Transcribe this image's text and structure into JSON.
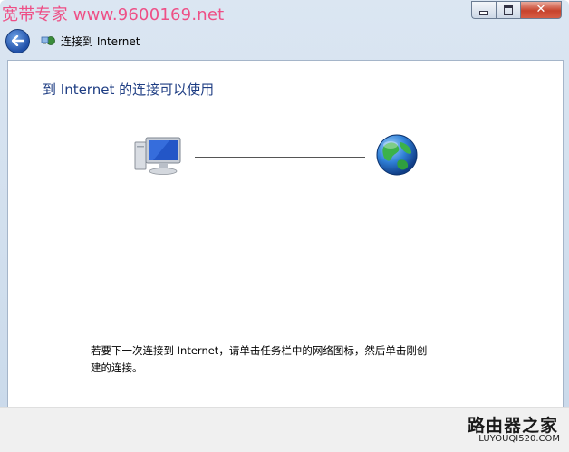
{
  "watermark": "宽带专家 www.9600169.net",
  "window": {
    "minimize": "minimize",
    "maximize": "maximize",
    "close": "✕"
  },
  "nav": {
    "title": "连接到 Internet"
  },
  "content": {
    "heading": "到 Internet 的连接可以使用",
    "instruction": "若要下一次连接到 Internet，请单击任务栏中的网络图标，然后单击刚创建的连接。"
  },
  "brand": {
    "name": "路由器之家",
    "url": "LUYOUQI520.COM"
  },
  "colors": {
    "heading": "#1e3d83",
    "watermark": "#ee4f86",
    "close_button": "#c7432c"
  }
}
